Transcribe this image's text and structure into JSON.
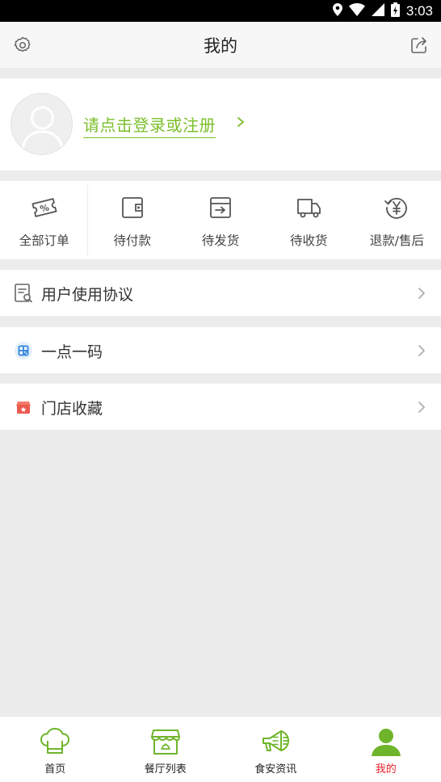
{
  "status_bar": {
    "time": "3:03",
    "icons": [
      "location-icon",
      "wifi-icon",
      "signal-icon",
      "battery-icon"
    ]
  },
  "header": {
    "title": "我的",
    "left_icon": "settings-icon",
    "right_icon": "share-icon"
  },
  "profile": {
    "login_text": "请点击登录或注册",
    "accent_color": "#7bbf2a"
  },
  "orders": [
    {
      "label": "全部订单",
      "icon": "coupon-icon"
    },
    {
      "label": "待付款",
      "icon": "wallet-icon"
    },
    {
      "label": "待发货",
      "icon": "box-icon"
    },
    {
      "label": "待收货",
      "icon": "truck-icon"
    },
    {
      "label": "退款/售后",
      "icon": "refund-yen-icon"
    }
  ],
  "menu": [
    {
      "label": "用户使用协议",
      "icon": "agreement-icon"
    },
    {
      "label": "一点一码",
      "icon": "qrcode-icon"
    },
    {
      "label": "门店收藏",
      "icon": "store-favorite-icon"
    }
  ],
  "bottom_nav": [
    {
      "label": "首页",
      "icon": "chef-hat-icon"
    },
    {
      "label": "餐厅列表",
      "icon": "restaurant-icon"
    },
    {
      "label": "食安资讯",
      "icon": "megaphone-icon"
    },
    {
      "label": "我的",
      "icon": "user-icon",
      "active": true
    }
  ],
  "colors": {
    "accent": "#7bbf2a",
    "nav_active": "#e8222d",
    "nav_icon": "#6fb52c"
  }
}
